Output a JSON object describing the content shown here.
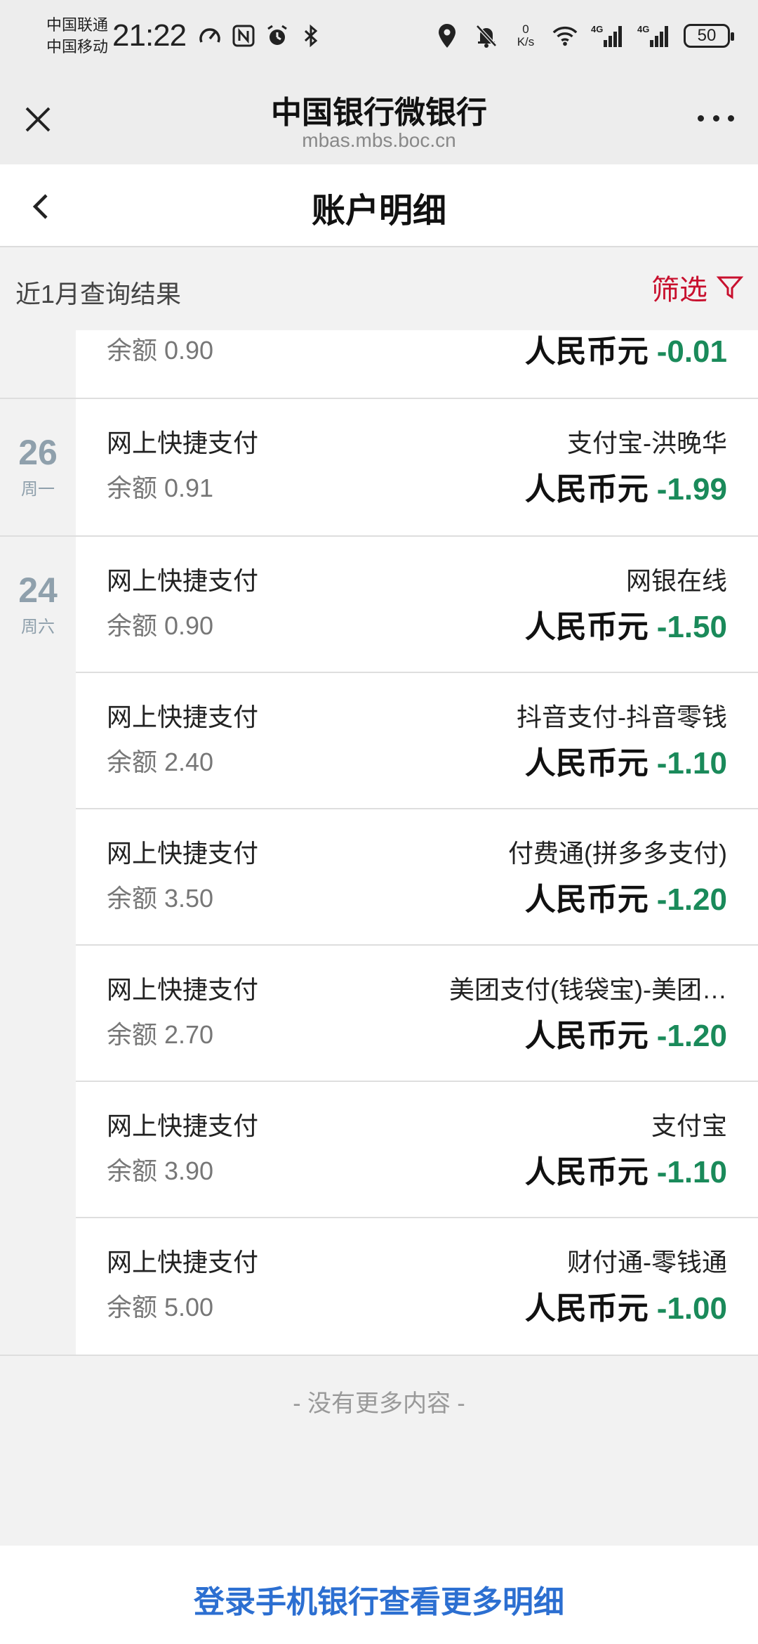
{
  "status_bar": {
    "carrier1": "中国联通",
    "carrier2": "中国移动",
    "time": "21:22",
    "net_speed_value": "0",
    "net_speed_unit": "K/s",
    "signal1_label": "4G",
    "signal2_label": "4G",
    "battery": "50",
    "icons_left": [
      "speedometer-icon",
      "nfc-icon",
      "alarm-icon",
      "bluetooth-icon"
    ],
    "icons_right": [
      "location-icon",
      "mute-bell-icon",
      "wifi-icon",
      "signal-icon",
      "signal-icon",
      "battery-icon"
    ]
  },
  "browser": {
    "title": "中国银行微银行",
    "url": "mbas.mbs.boc.cn",
    "close_icon": "close-icon",
    "more_icon": "more-dots-icon"
  },
  "page": {
    "title": "账户明细",
    "back_icon": "chevron-left-icon"
  },
  "filter": {
    "range_label": "近1月查询结果",
    "filter_label": "筛选",
    "filter_icon": "funnel-icon",
    "accent_color": "#c8102e"
  },
  "partial_item": {
    "balance": "余额 0.90",
    "currency": "人民币元",
    "amount": "-0.01"
  },
  "groups": [
    {
      "day": "26",
      "weekday": "周一",
      "items": [
        {
          "type": "网上快捷支付",
          "merchant": "支付宝-洪晚华",
          "balance": "余额 0.91",
          "currency": "人民币元",
          "amount": "-1.99"
        }
      ]
    },
    {
      "day": "24",
      "weekday": "周六",
      "items": [
        {
          "type": "网上快捷支付",
          "merchant": "网银在线",
          "balance": "余额 0.90",
          "currency": "人民币元",
          "amount": "-1.50"
        },
        {
          "type": "网上快捷支付",
          "merchant": "抖音支付-抖音零钱",
          "balance": "余额 2.40",
          "currency": "人民币元",
          "amount": "-1.10"
        },
        {
          "type": "网上快捷支付",
          "merchant": "付费通(拼多多支付)",
          "balance": "余额 3.50",
          "currency": "人民币元",
          "amount": "-1.20"
        },
        {
          "type": "网上快捷支付",
          "merchant": "美团支付(钱袋宝)-美团…",
          "balance": "余额 2.70",
          "currency": "人民币元",
          "amount": "-1.20"
        },
        {
          "type": "网上快捷支付",
          "merchant": "支付宝",
          "balance": "余额 3.90",
          "currency": "人民币元",
          "amount": "-1.10"
        },
        {
          "type": "网上快捷支付",
          "merchant": "财付通-零钱通",
          "balance": "余额 5.00",
          "currency": "人民币元",
          "amount": "-1.00"
        }
      ]
    }
  ],
  "footer": {
    "no_more": "- 没有更多内容 -",
    "login_link": "登录手机银行查看更多明细",
    "link_color": "#2c6fd1",
    "amount_color": "#1a8a5a"
  }
}
